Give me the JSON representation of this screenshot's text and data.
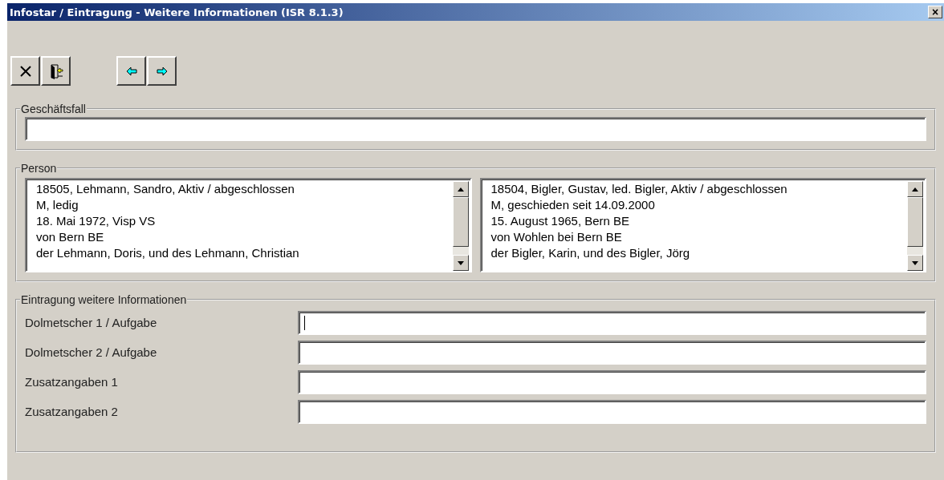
{
  "window": {
    "title": "Infostar / Eintragung - Weitere Informationen (ISR 8.1.3)",
    "close": "×"
  },
  "toolbar": [
    {
      "kind": "cancel"
    },
    {
      "kind": "exit"
    },
    {
      "kind": "back"
    },
    {
      "kind": "forward"
    }
  ],
  "geschaeftsfall": {
    "legend": "Geschäftsfall"
  },
  "person": {
    "legend": "Person",
    "lists": [
      {
        "lines": [
          "18505, Lehmann, Sandro, Aktiv / abgeschlossen",
          "M, ledig",
          "18. Mai 1972, Visp VS",
          "von Bern BE",
          "der Lehmann, Doris, und des Lehmann, Christian"
        ]
      },
      {
        "lines": [
          "18504, Bigler, Gustav, led. Bigler, Aktiv / abgeschlossen",
          "M, geschieden seit 14.09.2000",
          "15. August 1965, Bern BE",
          "von Wohlen bei Bern BE",
          "der Bigler, Karin, und des Bigler, Jörg"
        ]
      }
    ]
  },
  "eintragung": {
    "legend": "Eintragung weitere Informationen",
    "fields": [
      {
        "label": "Dolmetscher 1 / Aufgabe",
        "focused": true
      },
      {
        "label": "Dolmetscher 2 / Aufgabe",
        "focused": false
      },
      {
        "label": "Zusatzangaben 1",
        "focused": false
      },
      {
        "label": "Zusatzangaben 2",
        "focused": false
      }
    ]
  }
}
